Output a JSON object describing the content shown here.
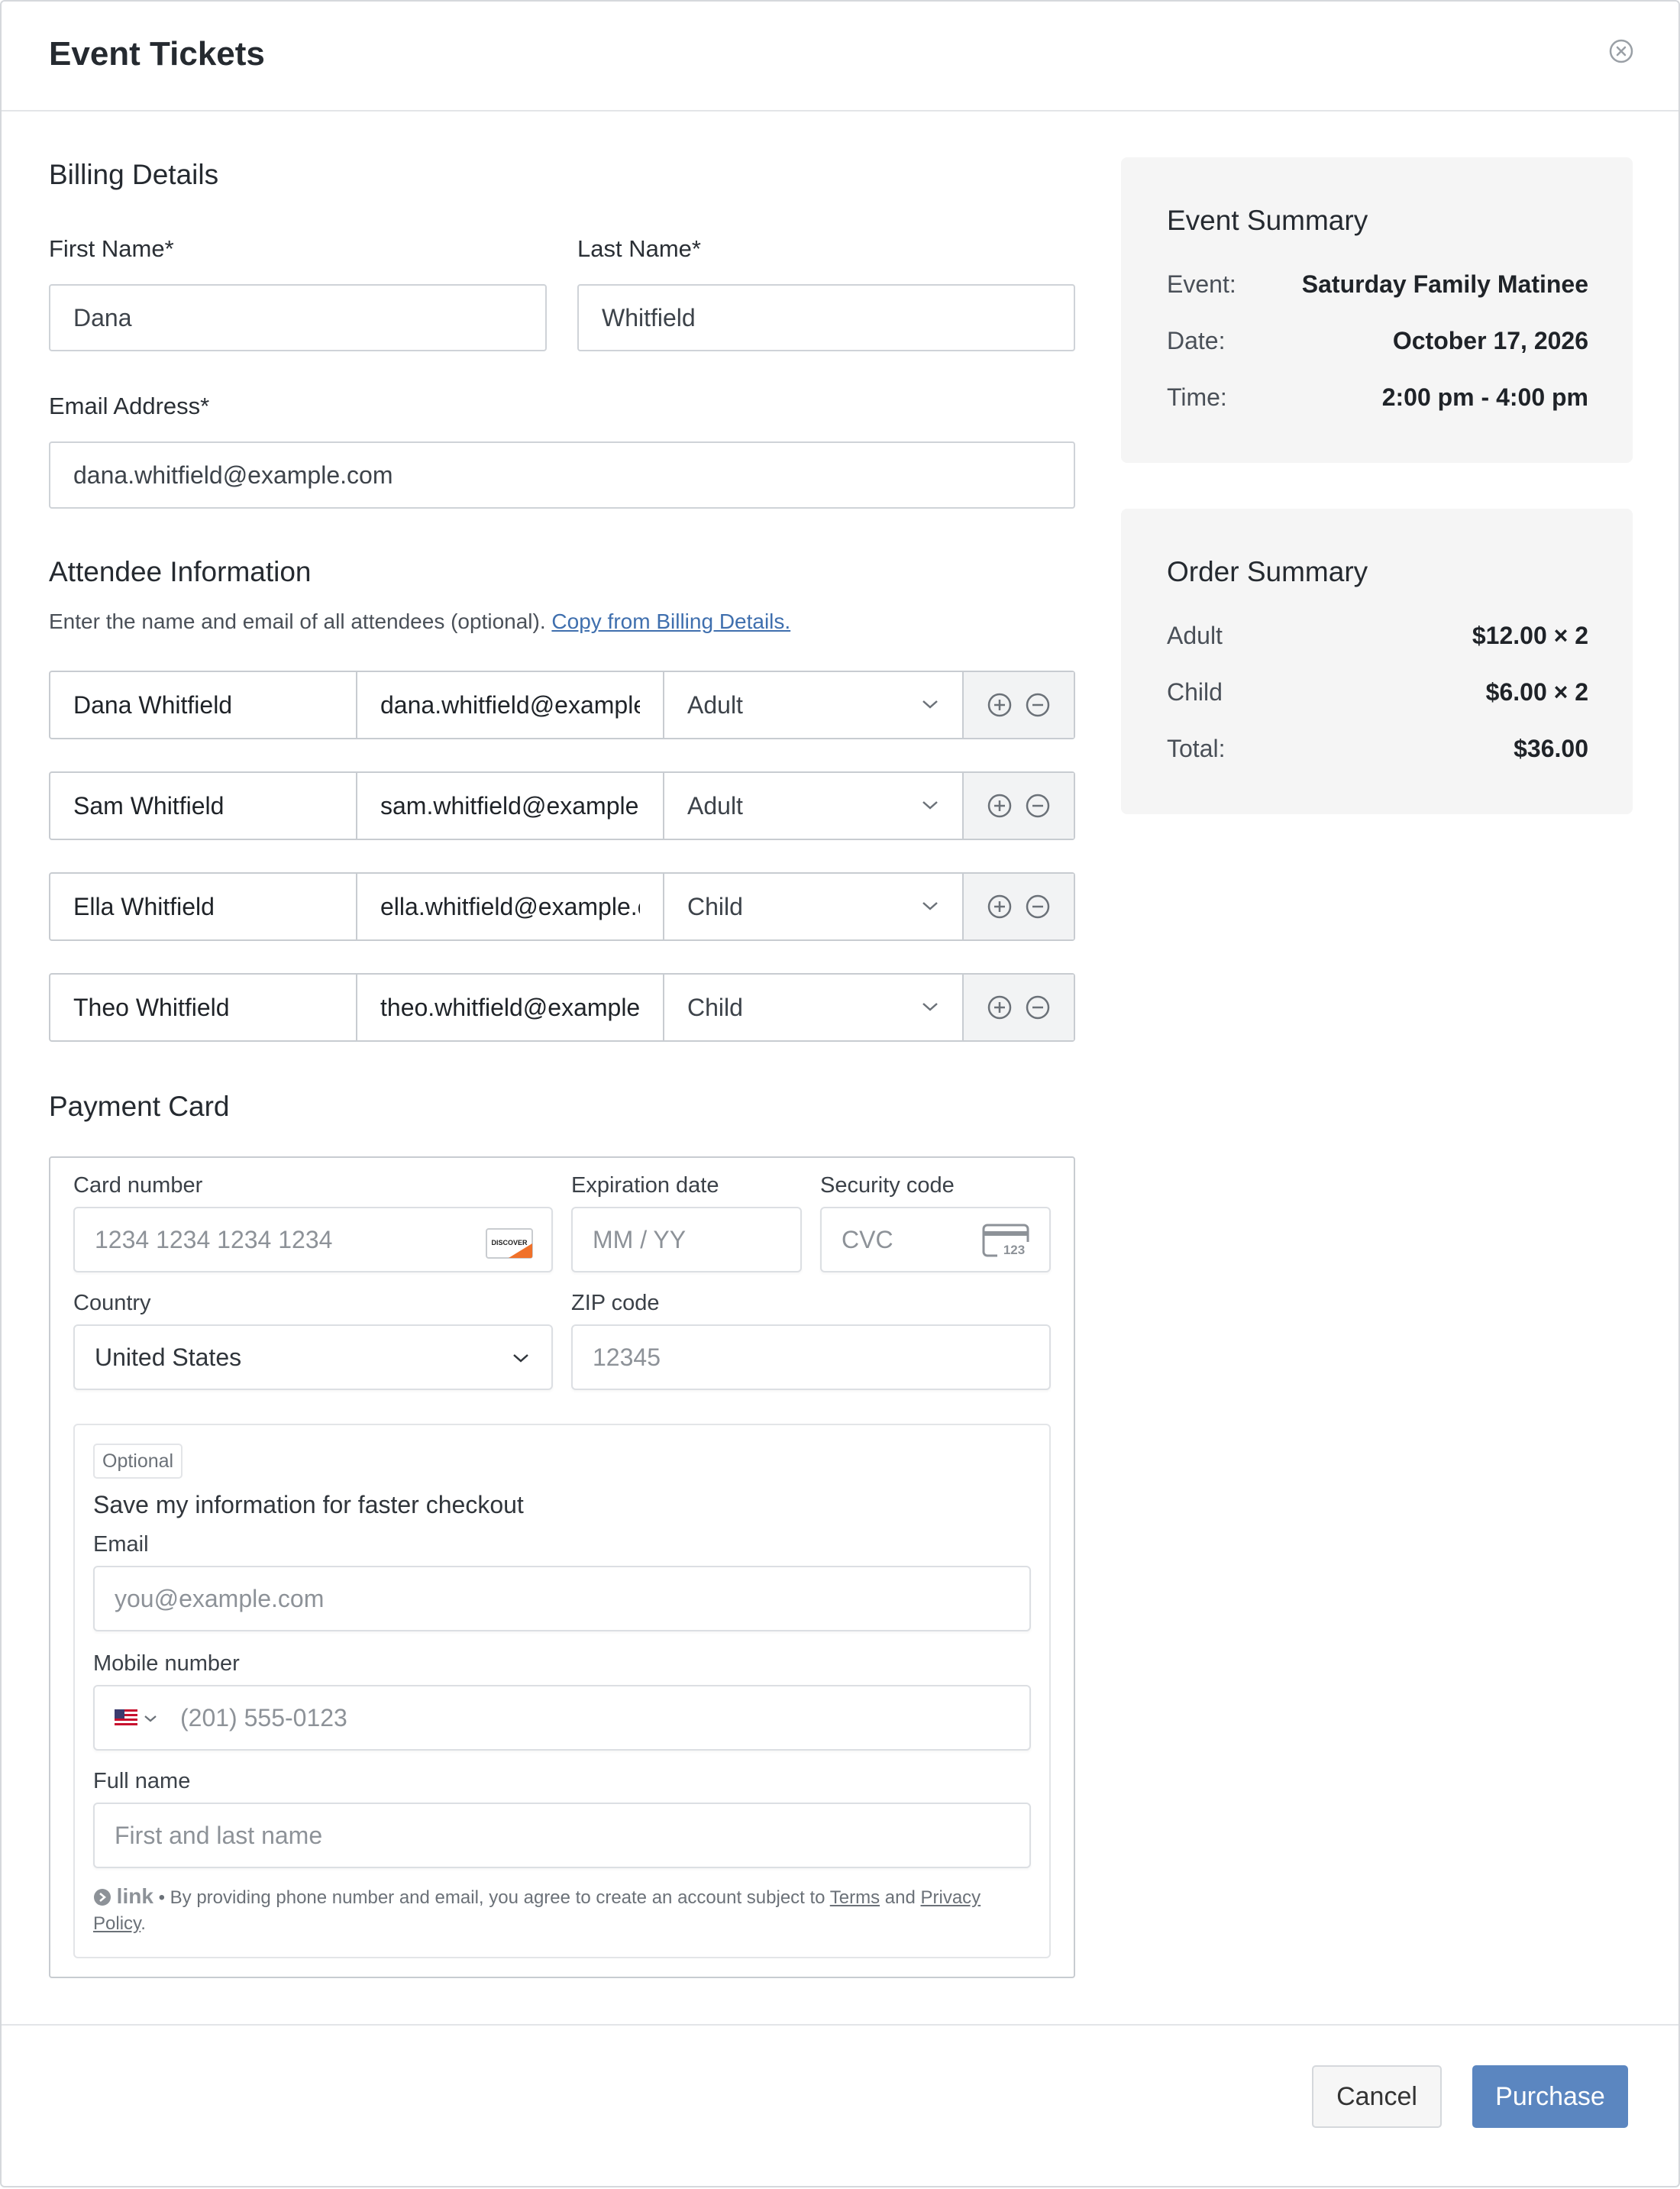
{
  "modal": {
    "title": "Event Tickets"
  },
  "billing": {
    "title": "Billing Details",
    "first_name_label": "First Name*",
    "first_name_value": "Dana",
    "last_name_label": "Last Name*",
    "last_name_value": "Whitfield",
    "email_label": "Email Address*",
    "email_value": "dana.whitfield@example.com"
  },
  "attendees": {
    "title": "Attendee Information",
    "note": "Enter the name and email of all attendees (optional). ",
    "copy_link": "Copy from Billing Details.",
    "rows": [
      {
        "name": "Dana Whitfield",
        "email": "dana.whitfield@example.com",
        "type": "Adult"
      },
      {
        "name": "Sam Whitfield",
        "email": "sam.whitfield@example.com",
        "type": "Adult"
      },
      {
        "name": "Ella Whitfield",
        "email": "ella.whitfield@example.com",
        "type": "Child"
      },
      {
        "name": "Theo Whitfield",
        "email": "theo.whitfield@example.com",
        "type": "Child"
      }
    ]
  },
  "payment": {
    "title": "Payment Card",
    "card_number_label": "Card number",
    "card_number_placeholder": "1234 1234 1234 1234",
    "card_brand": "DISCOVER",
    "expiration_label": "Expiration date",
    "expiration_placeholder": "MM / YY",
    "security_label": "Security code",
    "security_placeholder": "CVC",
    "cvc_icon_text": "123",
    "country_label": "Country",
    "country_value": "United States",
    "zip_label": "ZIP code",
    "zip_placeholder": "12345",
    "link": {
      "badge": "Optional",
      "save_text": "Save my information for faster checkout",
      "email_label": "Email",
      "email_placeholder": "you@example.com",
      "mobile_label": "Mobile number",
      "mobile_placeholder": "(201) 555-0123",
      "fullname_label": "Full name",
      "fullname_placeholder": "First and last name",
      "brand": "link",
      "legal_prefix": " • By providing phone number and email, you agree to create an account subject to ",
      "terms": "Terms",
      "and": " and ",
      "privacy": "Privacy Policy",
      "period": "."
    }
  },
  "event_summary": {
    "title": "Event Summary",
    "rows": [
      {
        "key": "Event:",
        "value": "Saturday Family Matinee"
      },
      {
        "key": "Date:",
        "value": "October 17, 2026"
      },
      {
        "key": "Time:",
        "value": "2:00 pm - 4:00 pm"
      }
    ]
  },
  "order_summary": {
    "title": "Order Summary",
    "rows": [
      {
        "key": "Adult",
        "value": "$12.00 × 2"
      },
      {
        "key": "Child",
        "value": "$6.00 × 2"
      },
      {
        "key": "Total:",
        "value": "$36.00"
      }
    ]
  },
  "footer": {
    "cancel_label": "Cancel",
    "purchase_label": "Purchase"
  },
  "colors": {
    "primary": "#5b86c0",
    "link": "#3f6fae",
    "summary_bg": "#f5f5f5"
  }
}
